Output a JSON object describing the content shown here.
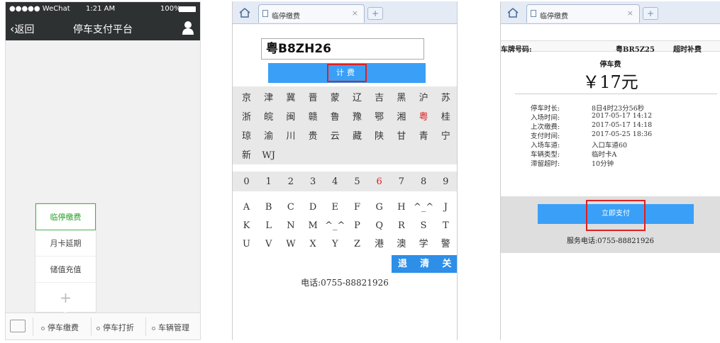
{
  "panel1": {
    "status": {
      "carrier": "●●●●● WeChat",
      "time": "1:21 AM",
      "battery": "100%"
    },
    "nav": {
      "back_label": "返回",
      "title": "停车支付平台"
    },
    "popup_items": [
      "临停缴费",
      "月卡延期",
      "储值充值"
    ],
    "popup_plus": "+",
    "tabs": [
      "停车缴费",
      "停车打折",
      "车辆管理"
    ]
  },
  "panel2": {
    "tab_title": "临停缴费",
    "tab_close": "×",
    "newtab": "+",
    "plate_value": "粤B8ZH26",
    "calc_label": "计费",
    "province_rows": [
      [
        "京",
        "津",
        "冀",
        "晋",
        "蒙",
        "辽",
        "吉",
        "黑",
        "沪",
        "苏"
      ],
      [
        "浙",
        "皖",
        "闽",
        "赣",
        "鲁",
        "豫",
        "鄂",
        "湘",
        "粤",
        "桂"
      ],
      [
        "琼",
        "渝",
        "川",
        "贵",
        "云",
        "藏",
        "陕",
        "甘",
        "青",
        "宁"
      ],
      [
        "新",
        "WJ",
        "",
        "",
        "",
        "",
        "",
        "",
        "",
        ""
      ]
    ],
    "digit_row": [
      "0",
      "1",
      "2",
      "3",
      "4",
      "5",
      "6",
      "7",
      "8",
      "9"
    ],
    "letter_rows": [
      [
        "A",
        "B",
        "C",
        "D",
        "E",
        "F",
        "G",
        "H",
        "^_^",
        "J"
      ],
      [
        "K",
        "L",
        "N",
        "M",
        "^_^",
        "P",
        "Q",
        "R",
        "S",
        "T"
      ],
      [
        "U",
        "V",
        "W",
        "X",
        "Y",
        "Z",
        "港",
        "澳",
        "学",
        "警"
      ]
    ],
    "action_keys": [
      "退",
      "清",
      "关"
    ],
    "phone": "电话:0755-88821926",
    "colors": {
      "accent": "#3aa0f7",
      "highlight": "#e02020"
    }
  },
  "panel3": {
    "tab_title": "临停缴费",
    "tab_close": "×",
    "newtab": "+",
    "plate_label": "车牌号码:",
    "plate_value": "粤BR5Z25",
    "overtime_label": "超时补费",
    "fee_label": "停车费",
    "amount": "￥17元",
    "details": [
      {
        "label": "停车时长:",
        "value": "8日4时23分56秒"
      },
      {
        "label": "入场时间:",
        "value": "2017-05-17 14:12"
      },
      {
        "label": "上次缴费:",
        "value": "2017-05-17 14:18"
      },
      {
        "label": "支付时间:",
        "value": "2017-05-25 18:36"
      },
      {
        "label": "入场车道:",
        "value": "入口车道60"
      },
      {
        "label": "车辆类型:",
        "value": "临时卡A"
      },
      {
        "label": "滞留超时:",
        "value": "10分钟"
      }
    ],
    "pay_label": "立即支付",
    "service_phone": "服务电话:0755-88821926"
  }
}
